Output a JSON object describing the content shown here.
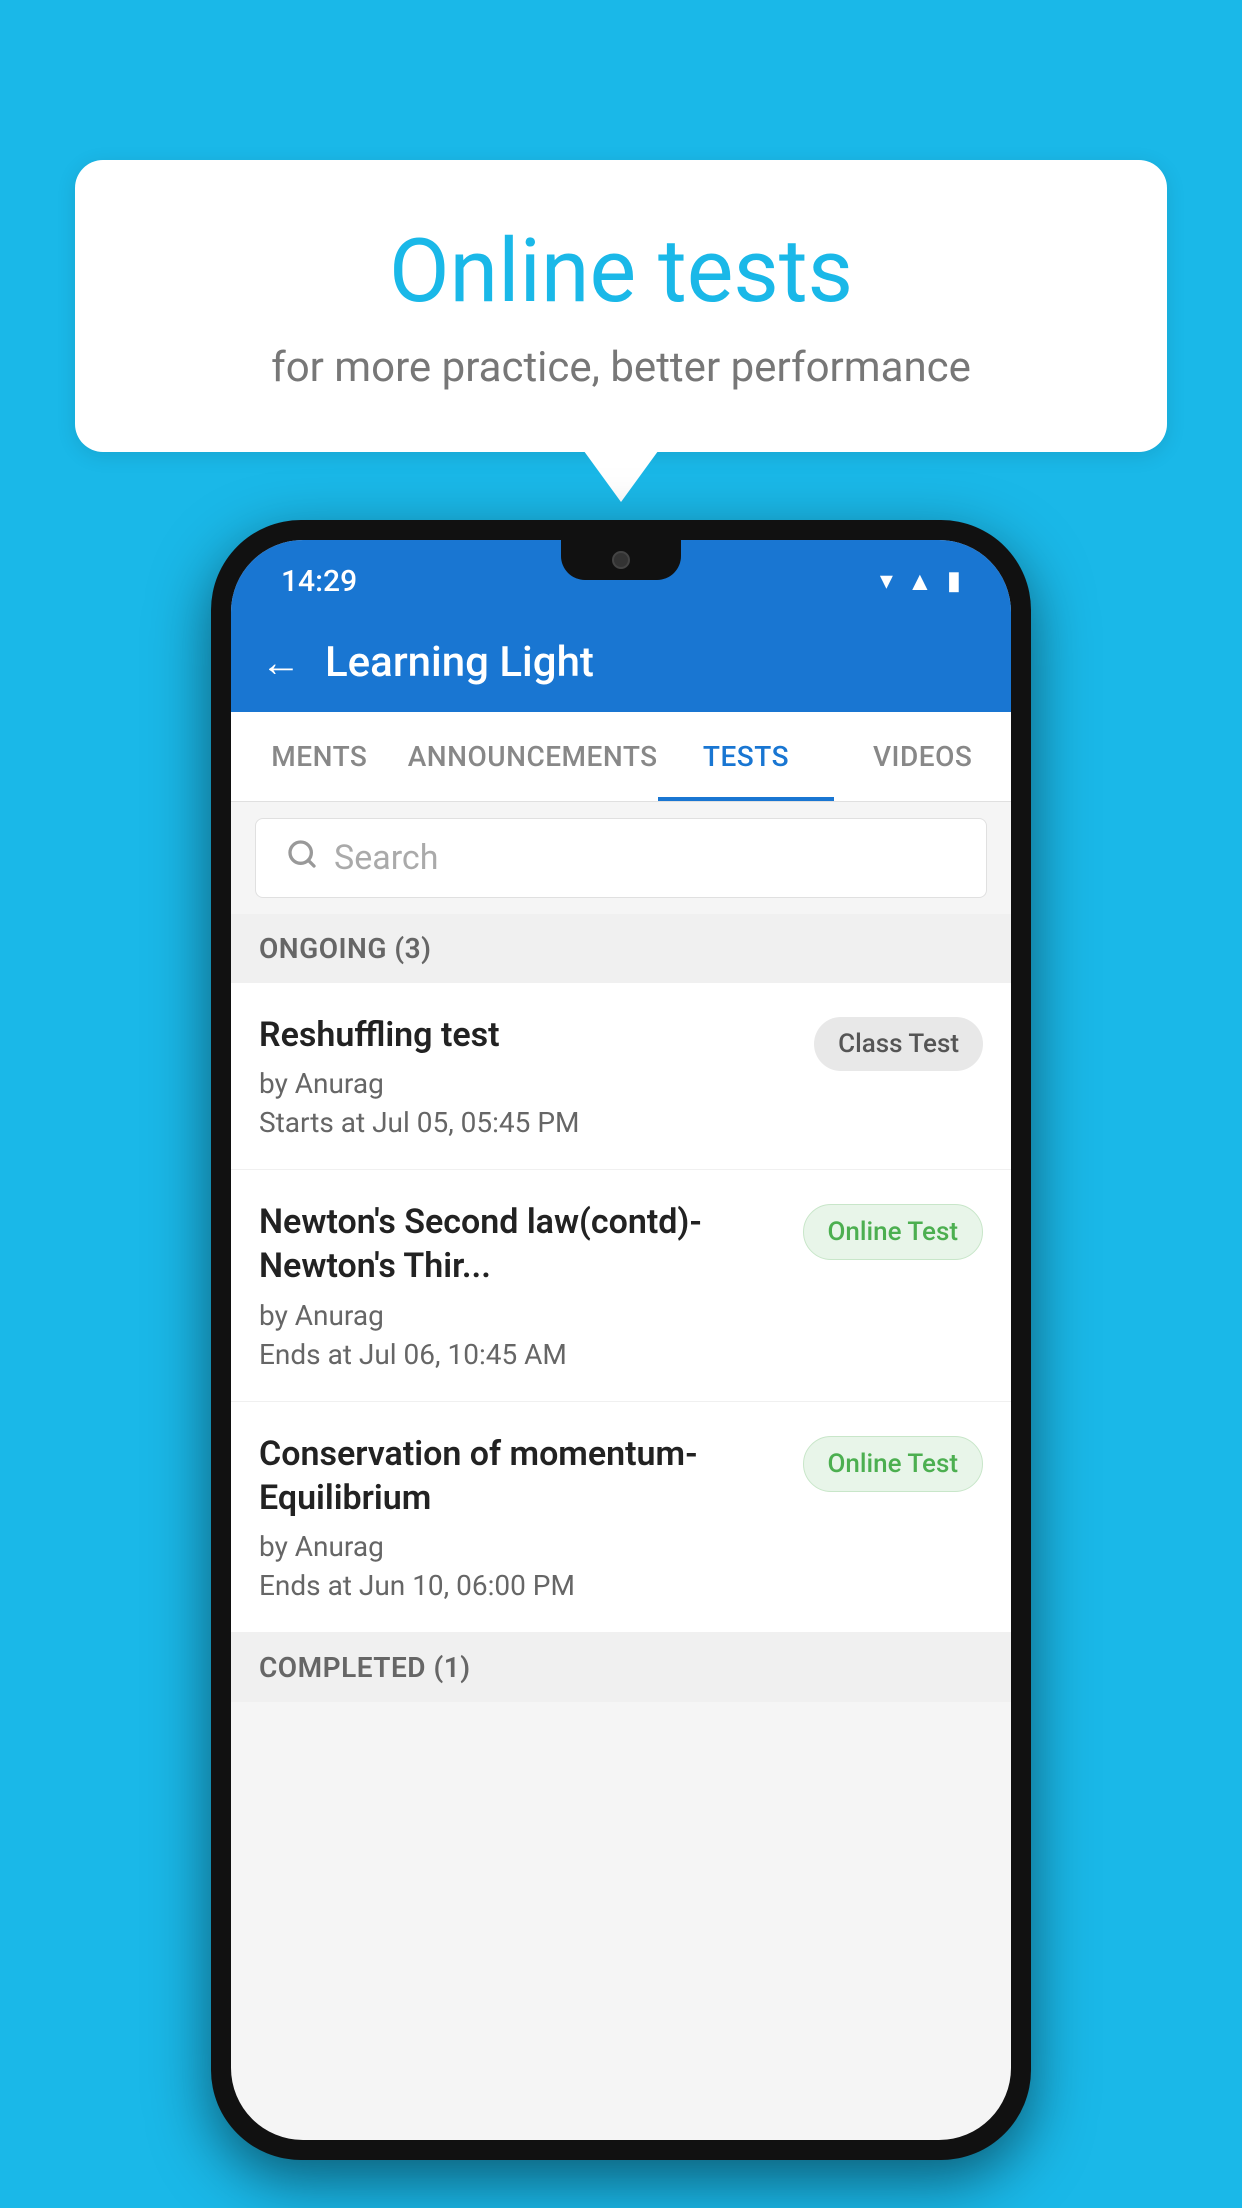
{
  "background_color": "#1ab8e8",
  "bubble": {
    "title": "Online tests",
    "subtitle": "for more practice, better performance"
  },
  "phone": {
    "status_bar": {
      "time": "14:29",
      "icons": [
        "wifi",
        "signal",
        "battery"
      ]
    },
    "app_bar": {
      "back_label": "←",
      "title": "Learning Light"
    },
    "tabs": [
      {
        "label": "MENTS",
        "active": false
      },
      {
        "label": "ANNOUNCEMENTS",
        "active": false
      },
      {
        "label": "TESTS",
        "active": true
      },
      {
        "label": "VIDEOS",
        "active": false
      }
    ],
    "search": {
      "placeholder": "Search"
    },
    "sections": [
      {
        "header": "ONGOING (3)",
        "items": [
          {
            "title": "Reshuffling test",
            "author": "by Anurag",
            "date": "Starts at  Jul 05, 05:45 PM",
            "badge": "Class Test",
            "badge_type": "class"
          },
          {
            "title": "Newton's Second law(contd)-Newton's Thir...",
            "author": "by Anurag",
            "date": "Ends at  Jul 06, 10:45 AM",
            "badge": "Online Test",
            "badge_type": "online"
          },
          {
            "title": "Conservation of momentum-Equilibrium",
            "author": "by Anurag",
            "date": "Ends at  Jun 10, 06:00 PM",
            "badge": "Online Test",
            "badge_type": "online"
          }
        ]
      },
      {
        "header": "COMPLETED (1)",
        "items": []
      }
    ]
  }
}
